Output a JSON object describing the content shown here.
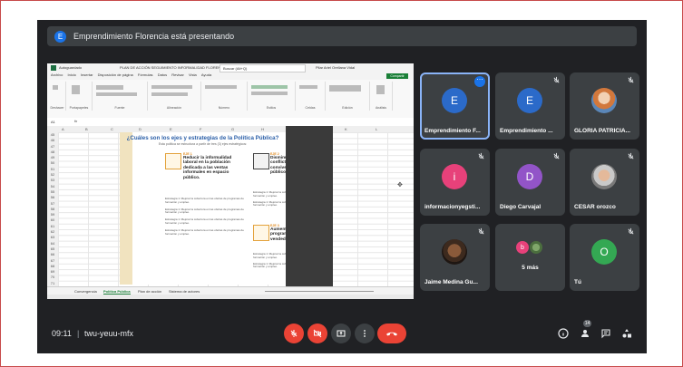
{
  "banner": {
    "avatar": "E",
    "text": "Emprendimiento Florencia está presentando"
  },
  "excel": {
    "app_label": "Autoguardado",
    "doc_title": "PLAN DE ACCIÓN SEGUIMIENTO INFORMALIDAD FLORENCIA",
    "search": "Buscar (Alt+Q)",
    "user": "Pilar Ariel Orellana Vidal",
    "menu": [
      "Archivo",
      "Inicio",
      "Insertar",
      "Disposición de página",
      "Fórmulas",
      "Datos",
      "Revisar",
      "Vista",
      "Ayuda"
    ],
    "share": "Compartir",
    "ribbon_groups": [
      "Deshacer",
      "Portapapeles",
      "Fuente",
      "Alineación",
      "Número",
      "Estilos",
      "Celdas",
      "Edición",
      "Análisis"
    ],
    "cell_ref": "A1",
    "columns": [
      "A",
      "B",
      "C",
      "D",
      "E",
      "F",
      "G",
      "H",
      "I",
      "J",
      "K",
      "L"
    ],
    "rows": [
      "45",
      "46",
      "47",
      "48",
      "49",
      "50",
      "51",
      "52",
      "53",
      "54",
      "55",
      "56",
      "57",
      "58",
      "59",
      "60",
      "61",
      "62",
      "63",
      "64",
      "65",
      "66",
      "67",
      "68",
      "69",
      "70",
      "71"
    ],
    "tabs": [
      "Convergencia",
      "Política Pública",
      "Plan de acción",
      "Sistema de actores"
    ],
    "active_tab": "Política Pública",
    "infographic": {
      "title": "¿Cuáles son los ejes y estrategias de la Política Pública?",
      "subtitle": "Esta política se estructura a partir de tres (3) ejes estratégicos:",
      "eje1": {
        "code": "EJE 1",
        "head": "Reducir la informalidad laboral en la población dedicada a las ventas informales en espacio público."
      },
      "eje2": {
        "code": "EJE 2",
        "head": "Disminuir la incidencia de conflictividad por el uso y la convivencia en el espacio público."
      },
      "eje3": {
        "code": "EJE 3",
        "head": "Aumentar el impacto de programas dirigidos a los vendedores informales."
      },
      "body": "Estrategia 1: Mejorar la cobertura en las ofertas de programas de formación y empleo."
    }
  },
  "participants": [
    {
      "name": "Emprendimiento F...",
      "initial": "E",
      "color": "#2b6ac9",
      "active": true
    },
    {
      "name": "Emprendimiento ...",
      "initial": "E",
      "color": "#2b6ac9"
    },
    {
      "name": "GLORIA PATRICIA...",
      "photo": true
    },
    {
      "name": "informacionyegsti...",
      "initial": "i",
      "color": "#e7417a"
    },
    {
      "name": "Diego Carvajal",
      "initial": "D",
      "color": "#9254c8"
    },
    {
      "name": "CESAR orozco",
      "photo": true
    },
    {
      "name": "Jaime Medina Gu...",
      "photo": true
    },
    {
      "name": "5 más",
      "initial": "b",
      "color": "#e7417a"
    },
    {
      "name": "Tú",
      "initial": "O",
      "color": "#34a853"
    }
  ],
  "bottom": {
    "time": "09:11",
    "separator": "|",
    "meeting_code": "twu-yeuu-mfx",
    "people_count": "14"
  }
}
